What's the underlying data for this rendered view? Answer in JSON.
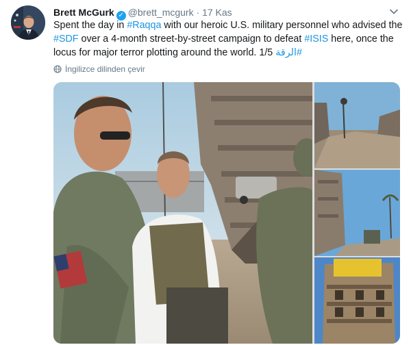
{
  "tweet": {
    "display_name": "Brett McGurk",
    "handle": "@brett_mcgurk",
    "separator": "·",
    "timestamp": "17 Kas",
    "text_parts": [
      {
        "text": "Spent the day in ",
        "type": "text"
      },
      {
        "text": "#Raqqa",
        "type": "hashtag"
      },
      {
        "text": " with our heroic U.S. military personnel who advised the ",
        "type": "text"
      },
      {
        "text": "#SDF",
        "type": "hashtag"
      },
      {
        "text": " over a 4-month street-by-street campaign to defeat ",
        "type": "text"
      },
      {
        "text": "#ISIS",
        "type": "hashtag"
      },
      {
        "text": " here, once the locus for major terror plotting around the world. 1/5 ",
        "type": "text"
      },
      {
        "text": "#الرقة",
        "type": "hashtag"
      }
    ],
    "translate_label": "İngilizce dilinden çevir",
    "icons": {
      "verified": "verified-badge-icon",
      "caret": "chevron-down-icon",
      "translate": "globe-icon"
    }
  },
  "colors": {
    "link": "#1b95e0",
    "verified": "#1da1f2",
    "muted": "#657786"
  }
}
